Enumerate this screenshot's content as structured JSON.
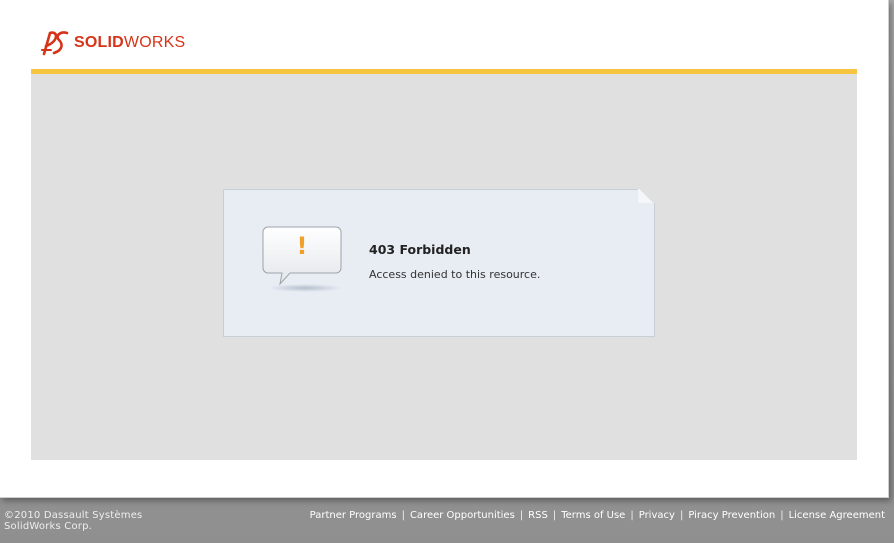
{
  "header": {
    "logo_solid": "SOLID",
    "logo_works": "WORKS",
    "logo_icon": "ds-logo-icon"
  },
  "colors": {
    "brand": "#d63418",
    "accent_bar": "#f6c43f",
    "alert": "#f0a028"
  },
  "message": {
    "icon": "exclamation-bubble-icon",
    "mark": "!",
    "title": "403 Forbidden",
    "description": "Access denied to this resource."
  },
  "footer": {
    "copyright_line1": "©2010 Dassault Systèmes",
    "copyright_line2": "SolidWorks Corp.",
    "links": [
      {
        "label": "Partner Programs"
      },
      {
        "label": "Career Opportunities"
      },
      {
        "label": "RSS"
      },
      {
        "label": "Terms of Use"
      },
      {
        "label": "Privacy"
      },
      {
        "label": "Piracy Prevention"
      },
      {
        "label": "License Agreement"
      }
    ]
  }
}
